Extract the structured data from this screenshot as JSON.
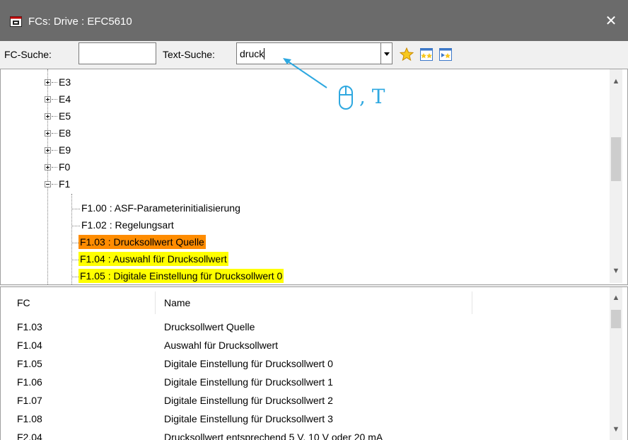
{
  "window": {
    "title": "FCs: Drive : EFC5610",
    "close_glyph": "✕"
  },
  "toolbar": {
    "fc_search_label": "FC-Suche:",
    "fc_search_value": "",
    "text_search_label": "Text-Suche:",
    "text_search_value": "druck",
    "icons": [
      "favorite-star-icon",
      "expand-all-icon",
      "collapse-all-icon"
    ]
  },
  "tree": {
    "collapsed_nodes": [
      "E3",
      "E4",
      "E5",
      "E8",
      "E9",
      "F0"
    ],
    "expanded_node": "F1",
    "children": [
      {
        "label": "F1.00 : ASF-Parameterinitialisierung",
        "highlight": "none"
      },
      {
        "label": "F1.02 : Regelungsart",
        "highlight": "none"
      },
      {
        "label": "F1.03 : Drucksollwert Quelle",
        "highlight": "orange"
      },
      {
        "label": "F1.04 : Auswahl für Drucksollwert",
        "highlight": "yellow"
      },
      {
        "label": "F1.05 : Digitale Einstellung für Drucksollwert 0",
        "highlight": "yellow"
      }
    ]
  },
  "results": {
    "columns": [
      "FC",
      "Name"
    ],
    "rows": [
      {
        "fc": "F1.03",
        "name": "Drucksollwert Quelle"
      },
      {
        "fc": "F1.04",
        "name": "Auswahl für Drucksollwert"
      },
      {
        "fc": "F1.05",
        "name": "Digitale Einstellung für Drucksollwert 0"
      },
      {
        "fc": "F1.06",
        "name": "Digitale Einstellung für Drucksollwert 1"
      },
      {
        "fc": "F1.07",
        "name": "Digitale Einstellung für Drucksollwert 2"
      },
      {
        "fc": "F1.08",
        "name": "Digitale Einstellung für Drucksollwert 3"
      },
      {
        "fc": "F2.04",
        "name": "Drucksollwert entsprechend 5 V, 10 V oder 20 mA"
      }
    ]
  },
  "annotation": {
    "label": ", T",
    "icon": "mouse-icon",
    "color": "#2ea8e0"
  },
  "colors": {
    "titlebar": "#6b6b6b",
    "highlight_orange": "#ff8c00",
    "highlight_yellow": "#ffff00"
  }
}
